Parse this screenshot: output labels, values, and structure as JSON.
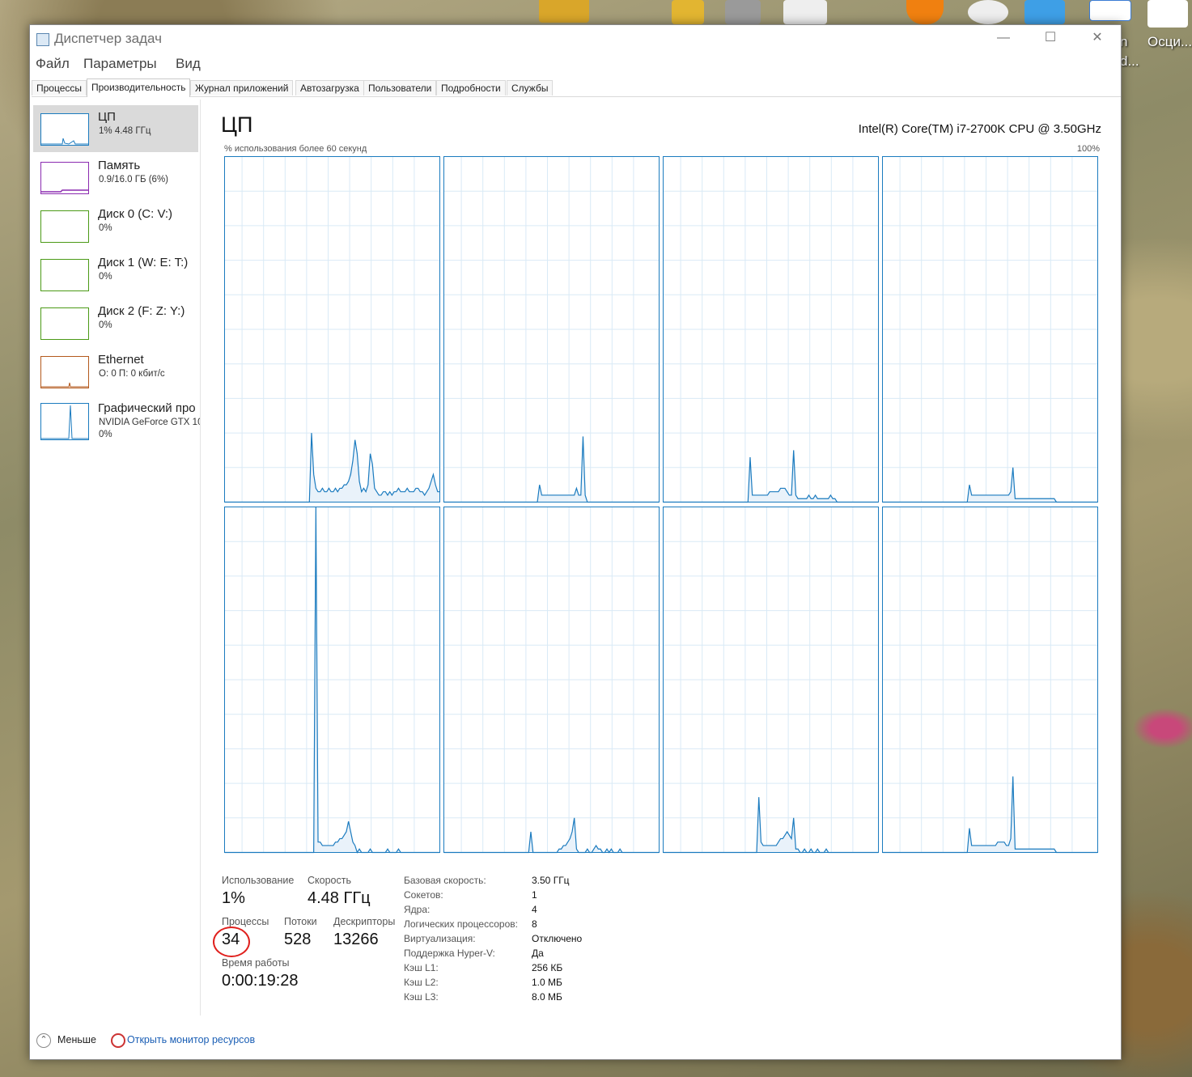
{
  "window": {
    "title": "Диспетчер задач",
    "controls": {
      "minimize": "—",
      "maximize": "☐",
      "close": "✕"
    }
  },
  "desktop": {
    "labels": [
      "n",
      "Осци...",
      "d..."
    ]
  },
  "menu": [
    "Файл",
    "Параметры",
    "Вид"
  ],
  "tabs": [
    "Процессы",
    "Производительность",
    "Журнал приложений",
    "Автозагрузка",
    "Пользователи",
    "Подробности",
    "Службы"
  ],
  "active_tab": "Производительность",
  "sidebar": {
    "items": [
      {
        "title": "ЦП",
        "sub": "1% 4.48 ГГц",
        "sub2": "",
        "color": "#1b7bbf",
        "icon": "cpu-graph-icon"
      },
      {
        "title": "Память",
        "sub": "0.9/16.0 ГБ (6%)",
        "sub2": "",
        "color": "#8b2bb0",
        "icon": "memory-graph-icon"
      },
      {
        "title": "Диск 0 (C: V:)",
        "sub": "0%",
        "sub2": "",
        "color": "#4b9a16",
        "icon": "disk-graph-icon"
      },
      {
        "title": "Диск 1 (W: E: T:)",
        "sub": "0%",
        "sub2": "",
        "color": "#4b9a16",
        "icon": "disk-graph-icon"
      },
      {
        "title": "Диск 2 (F: Z: Y:)",
        "sub": "0%",
        "sub2": "",
        "color": "#4b9a16",
        "icon": "disk-graph-icon"
      },
      {
        "title": "Ethernet",
        "sub": "О: 0 П: 0 кбит/с",
        "sub2": "",
        "color": "#b3591d",
        "icon": "ethernet-graph-icon"
      },
      {
        "title": "Графический про",
        "sub": "NVIDIA GeForce GTX 10",
        "sub2": "0%",
        "color": "#1b7bbf",
        "icon": "gpu-graph-icon"
      }
    ]
  },
  "main": {
    "title": "ЦП",
    "cpu_name": "Intel(R) Core(TM) i7-2700K CPU @ 3.50GHz",
    "graph_caption": "% использования более 60 секунд",
    "graph_max": "100%",
    "graph_color": "#1b7bbf"
  },
  "chart_data": {
    "type": "area",
    "title": "",
    "ylim": [
      0,
      100
    ],
    "grid": true,
    "series": [
      {
        "values": [
          0,
          0,
          0,
          0,
          0,
          0,
          0,
          0,
          0,
          0,
          0,
          0,
          0,
          0,
          0,
          0,
          0,
          0,
          0,
          0,
          0,
          0,
          0,
          0,
          0,
          0,
          0,
          0,
          0,
          0,
          0,
          0,
          0,
          0,
          0,
          0,
          0,
          0,
          0,
          0,
          20,
          8,
          4,
          3,
          3,
          4,
          3,
          3,
          4,
          3,
          3,
          4,
          3,
          4,
          4,
          5,
          5,
          6,
          8,
          12,
          18,
          14,
          6,
          3,
          4,
          3,
          5,
          14,
          11,
          4,
          3,
          2,
          2,
          3,
          3,
          2,
          3,
          2,
          3,
          3,
          4,
          3,
          3,
          3,
          4,
          3,
          3,
          3,
          4,
          4,
          3,
          3,
          2,
          3,
          4,
          6,
          8,
          5,
          3,
          3
        ]
      },
      {
        "values": [
          0,
          0,
          0,
          0,
          0,
          0,
          0,
          0,
          0,
          0,
          0,
          0,
          0,
          0,
          0,
          0,
          0,
          0,
          0,
          0,
          0,
          0,
          0,
          0,
          0,
          0,
          0,
          0,
          0,
          0,
          0,
          0,
          0,
          0,
          0,
          0,
          0,
          0,
          0,
          0,
          0,
          0,
          0,
          0,
          5,
          2,
          2,
          2,
          2,
          2,
          2,
          2,
          2,
          2,
          2,
          2,
          2,
          2,
          2,
          2,
          2,
          4,
          2,
          2,
          19,
          2,
          0,
          0,
          0,
          0,
          0,
          0,
          0,
          0,
          0,
          0,
          0,
          0,
          0,
          0,
          0,
          0,
          0,
          0,
          0,
          0,
          0,
          0,
          0,
          0,
          0,
          0,
          0,
          0,
          0,
          0,
          0,
          0,
          0,
          0
        ]
      },
      {
        "values": [
          0,
          0,
          0,
          0,
          0,
          0,
          0,
          0,
          0,
          0,
          0,
          0,
          0,
          0,
          0,
          0,
          0,
          0,
          0,
          0,
          0,
          0,
          0,
          0,
          0,
          0,
          0,
          0,
          0,
          0,
          0,
          0,
          0,
          0,
          0,
          0,
          0,
          0,
          0,
          0,
          13,
          2,
          2,
          2,
          2,
          2,
          2,
          2,
          2,
          3,
          3,
          3,
          3,
          3,
          4,
          4,
          4,
          3,
          2,
          2,
          15,
          2,
          1,
          1,
          1,
          1,
          1,
          2,
          1,
          1,
          2,
          1,
          1,
          1,
          1,
          1,
          1,
          2,
          1,
          1,
          0,
          0,
          0,
          0,
          0,
          0,
          0,
          0,
          0,
          0,
          0,
          0,
          0,
          0,
          0,
          0,
          0,
          0,
          0,
          0
        ]
      },
      {
        "values": [
          0,
          0,
          0,
          0,
          0,
          0,
          0,
          0,
          0,
          0,
          0,
          0,
          0,
          0,
          0,
          0,
          0,
          0,
          0,
          0,
          0,
          0,
          0,
          0,
          0,
          0,
          0,
          0,
          0,
          0,
          0,
          0,
          0,
          0,
          0,
          0,
          0,
          0,
          0,
          0,
          5,
          2,
          2,
          2,
          2,
          2,
          2,
          2,
          2,
          2,
          2,
          2,
          2,
          2,
          2,
          2,
          2,
          2,
          2,
          3,
          10,
          1,
          1,
          1,
          1,
          1,
          1,
          1,
          1,
          1,
          1,
          1,
          1,
          1,
          1,
          1,
          1,
          1,
          1,
          1,
          0,
          0,
          0,
          0,
          0,
          0,
          0,
          0,
          0,
          0,
          0,
          0,
          0,
          0,
          0,
          0,
          0,
          0,
          0,
          0
        ]
      },
      {
        "values": [
          0,
          0,
          0,
          0,
          0,
          0,
          0,
          0,
          0,
          0,
          0,
          0,
          0,
          0,
          0,
          0,
          0,
          0,
          0,
          0,
          0,
          0,
          0,
          0,
          0,
          0,
          0,
          0,
          0,
          0,
          0,
          0,
          0,
          0,
          0,
          0,
          0,
          0,
          0,
          0,
          0,
          0,
          100,
          3,
          3,
          2,
          2,
          2,
          2,
          2,
          2,
          3,
          3,
          4,
          4,
          5,
          6,
          9,
          6,
          3,
          2,
          0,
          1,
          0,
          0,
          0,
          0,
          1,
          0,
          0,
          0,
          0,
          0,
          0,
          0,
          1,
          0,
          0,
          0,
          0,
          1,
          0,
          0,
          0,
          0,
          0,
          0,
          0,
          0,
          0,
          0,
          0,
          0,
          0,
          0,
          0,
          0,
          0,
          0,
          0
        ]
      },
      {
        "values": [
          0,
          0,
          0,
          0,
          0,
          0,
          0,
          0,
          0,
          0,
          0,
          0,
          0,
          0,
          0,
          0,
          0,
          0,
          0,
          0,
          0,
          0,
          0,
          0,
          0,
          0,
          0,
          0,
          0,
          0,
          0,
          0,
          0,
          0,
          0,
          0,
          0,
          0,
          0,
          0,
          6,
          0,
          0,
          0,
          0,
          0,
          0,
          0,
          0,
          0,
          0,
          0,
          0,
          1,
          1,
          2,
          2,
          3,
          4,
          6,
          10,
          1,
          0,
          0,
          0,
          0,
          1,
          0,
          0,
          1,
          2,
          1,
          1,
          0,
          0,
          1,
          0,
          1,
          0,
          0,
          0,
          1,
          0,
          0,
          0,
          0,
          0,
          0,
          0,
          0,
          0,
          0,
          0,
          0,
          0,
          0,
          0,
          0,
          0,
          0
        ]
      },
      {
        "values": [
          0,
          0,
          0,
          0,
          0,
          0,
          0,
          0,
          0,
          0,
          0,
          0,
          0,
          0,
          0,
          0,
          0,
          0,
          0,
          0,
          0,
          0,
          0,
          0,
          0,
          0,
          0,
          0,
          0,
          0,
          0,
          0,
          0,
          0,
          0,
          0,
          0,
          0,
          0,
          0,
          0,
          0,
          0,
          0,
          16,
          3,
          2,
          2,
          2,
          2,
          2,
          2,
          2,
          3,
          4,
          4,
          5,
          6,
          5,
          4,
          10,
          1,
          1,
          0,
          0,
          1,
          0,
          0,
          1,
          0,
          0,
          1,
          0,
          0,
          0,
          1,
          0,
          0,
          0,
          0,
          0,
          0,
          0,
          0,
          0,
          0,
          0,
          0,
          0,
          0,
          0,
          0,
          0,
          0,
          0,
          0,
          0,
          0,
          0,
          0
        ]
      },
      {
        "values": [
          0,
          0,
          0,
          0,
          0,
          0,
          0,
          0,
          0,
          0,
          0,
          0,
          0,
          0,
          0,
          0,
          0,
          0,
          0,
          0,
          0,
          0,
          0,
          0,
          0,
          0,
          0,
          0,
          0,
          0,
          0,
          0,
          0,
          0,
          0,
          0,
          0,
          0,
          0,
          0,
          7,
          2,
          2,
          2,
          2,
          2,
          2,
          2,
          2,
          2,
          2,
          2,
          2,
          3,
          3,
          3,
          3,
          2,
          2,
          4,
          22,
          1,
          1,
          1,
          1,
          1,
          1,
          1,
          1,
          1,
          1,
          1,
          1,
          1,
          1,
          1,
          1,
          1,
          1,
          1,
          0,
          0,
          0,
          0,
          0,
          0,
          0,
          0,
          0,
          0,
          0,
          0,
          0,
          0,
          0,
          0,
          0,
          0,
          0,
          0
        ]
      }
    ]
  },
  "stats": {
    "usage_label": "Использование",
    "usage_value": "1%",
    "speed_label": "Скорость",
    "speed_value": "4.48 ГГц",
    "processes_label": "Процессы",
    "processes_value": "34",
    "threads_label": "Потоки",
    "threads_value": "528",
    "handles_label": "Дескрипторы",
    "handles_value": "13266",
    "uptime_label": "Время работы",
    "uptime_value": "0:00:19:28"
  },
  "specs": [
    {
      "label": "Базовая скорость:",
      "value": "3.50 ГГц"
    },
    {
      "label": "Сокетов:",
      "value": "1"
    },
    {
      "label": "Ядра:",
      "value": "4"
    },
    {
      "label": "Логических процессоров:",
      "value": "8"
    },
    {
      "label": "Виртуализация:",
      "value": "Отключено"
    },
    {
      "label": "Поддержка Hyper-V:",
      "value": "Да"
    },
    {
      "label": "Кэш L1:",
      "value": "256 КБ"
    },
    {
      "label": "Кэш L2:",
      "value": "1.0 МБ"
    },
    {
      "label": "Кэш L3:",
      "value": "8.0 МБ"
    }
  ],
  "footer": {
    "less_label": "Меньше",
    "monitor_link": "Открыть монитор ресурсов"
  }
}
